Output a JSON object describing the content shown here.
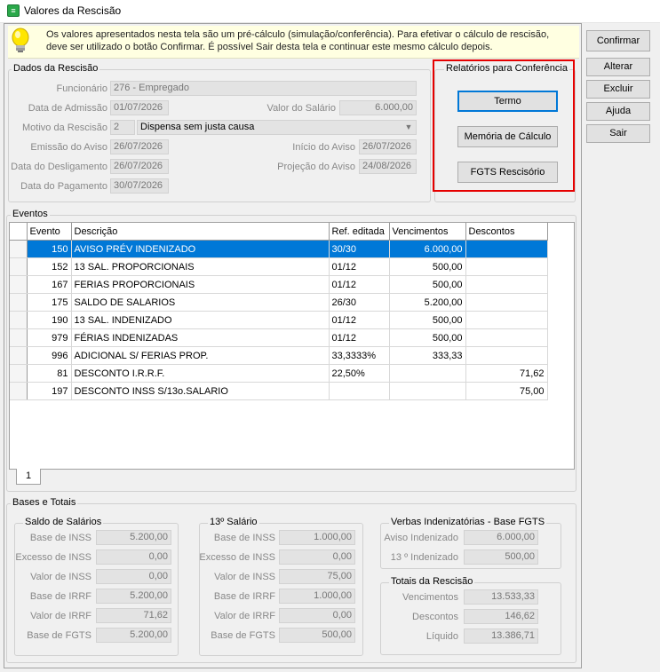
{
  "window": {
    "title": "Valores da Rescisão"
  },
  "info": {
    "text": "Os valores apresentados nesta tela são um pré-cálculo (simulação/conferência). Para efetivar o cálculo de rescisão, deve ser utilizado o botão Confirmar. É possível Sair desta tela e continuar este mesmo cálculo depois."
  },
  "dados": {
    "title": "Dados da Rescisão",
    "funcionario_label": "Funcionário",
    "funcionario_value": "276 - Empregado",
    "admissao_label": "Data de Admissão",
    "admissao_value": "01/07/2026",
    "salario_label": "Valor do Salário",
    "salario_value": "6.000,00",
    "motivo_label": "Motivo da Rescisão",
    "motivo_code": "2",
    "motivo_value": "Dispensa sem justa causa",
    "emissao_label": "Emissão do Aviso",
    "emissao_value": "26/07/2026",
    "inicio_label": "Início do Aviso",
    "inicio_value": "26/07/2026",
    "desligamento_label": "Data do Desligamento",
    "desligamento_value": "26/07/2026",
    "projecao_label": "Projeção do Aviso",
    "projecao_value": "24/08/2026",
    "pagamento_label": "Data do Pagamento",
    "pagamento_value": "30/07/2026"
  },
  "relatorios": {
    "title": "Relatórios para Conferência",
    "termo": "Termo",
    "memoria": "Memória de Cálculo",
    "fgts": "FGTS Rescisório"
  },
  "sidebar": {
    "confirmar": "Confirmar",
    "alterar": "Alterar",
    "excluir": "Excluir",
    "ajuda": "Ajuda",
    "sair": "Sair"
  },
  "eventos": {
    "title": "Eventos",
    "headers": [
      "Evento",
      "Descrição",
      "Ref. editada",
      "Vencimentos",
      "Descontos"
    ],
    "rows": [
      [
        "150",
        "AVISO PRÉV INDENIZADO",
        "30/30",
        "6.000,00",
        ""
      ],
      [
        "152",
        "13 SAL. PROPORCIONAIS",
        "01/12",
        "500,00",
        ""
      ],
      [
        "167",
        "FERIAS PROPORCIONAIS",
        "01/12",
        "500,00",
        ""
      ],
      [
        "175",
        "SALDO DE SALARIOS",
        "26/30",
        "5.200,00",
        ""
      ],
      [
        "190",
        "13 SAL. INDENIZADO",
        "01/12",
        "500,00",
        ""
      ],
      [
        "979",
        "FÉRIAS INDENIZADAS",
        "01/12",
        "500,00",
        ""
      ],
      [
        "996",
        "ADICIONAL S/ FERIAS PROP.",
        "33,3333%",
        "333,33",
        ""
      ],
      [
        "81",
        "DESCONTO I.R.R.F.",
        "22,50%",
        "",
        "71,62"
      ],
      [
        "197",
        "DESCONTO INSS S/13o.SALARIO",
        "",
        "",
        "75,00"
      ]
    ],
    "tab": "1"
  },
  "bases": {
    "title": "Bases e Totais",
    "saldo": {
      "title": "Saldo de Salários",
      "items": [
        {
          "label": "Base de INSS",
          "value": "5.200,00"
        },
        {
          "label": "Excesso de INSS",
          "value": "0,00"
        },
        {
          "label": "Valor de INSS",
          "value": "0,00"
        },
        {
          "label": "Base de IRRF",
          "value": "5.200,00"
        },
        {
          "label": "Valor de IRRF",
          "value": "71,62"
        },
        {
          "label": "Base de FGTS",
          "value": "5.200,00"
        }
      ]
    },
    "decimo": {
      "title": "13º Salário",
      "items": [
        {
          "label": "Base de INSS",
          "value": "1.000,00"
        },
        {
          "label": "Excesso de INSS",
          "value": "0,00"
        },
        {
          "label": "Valor de INSS",
          "value": "75,00"
        },
        {
          "label": "Base de IRRF",
          "value": "1.000,00"
        },
        {
          "label": "Valor de IRRF",
          "value": "0,00"
        },
        {
          "label": "Base de FGTS",
          "value": "500,00"
        }
      ]
    },
    "verbas": {
      "title": "Verbas Indenizatórias - Base FGTS",
      "items": [
        {
          "label": "Aviso Indenizado",
          "value": "6.000,00"
        },
        {
          "label": "13 º Indenizado",
          "value": "500,00"
        }
      ]
    },
    "totais": {
      "title": "Totais da Rescisão",
      "items": [
        {
          "label": "Vencimentos",
          "value": "13.533,33"
        },
        {
          "label": "Descontos",
          "value": "146,62"
        },
        {
          "label": "Líquido",
          "value": "13.386,71"
        }
      ]
    }
  }
}
